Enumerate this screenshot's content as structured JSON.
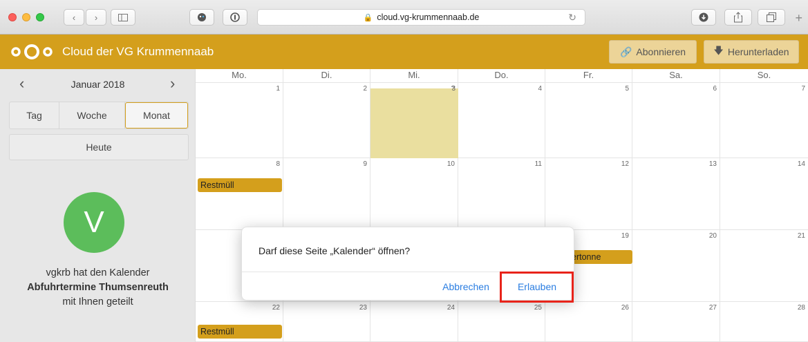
{
  "browser": {
    "url": "cloud.vg-krummennaab.de",
    "colors": {
      "close": "#fc605c",
      "minimize": "#fdbc40",
      "zoom": "#34c84a"
    }
  },
  "header": {
    "title": "Cloud der VG Krummennaab",
    "subscribe_label": "Abonnieren",
    "download_label": "Herunterladen",
    "accent": "#d49f1c"
  },
  "sidebar": {
    "month_label": "Januar 2018",
    "views": {
      "day": "Tag",
      "week": "Woche",
      "month": "Monat"
    },
    "today_label": "Heute",
    "avatar_letter": "V",
    "share_line1": "vgkrb hat den Kalender",
    "share_calendar": "Abfuhrtermine Thumsenreuth",
    "share_line3": "mit Ihnen geteilt"
  },
  "calendar": {
    "weekdays": [
      "Mo.",
      "Di.",
      "Mi.",
      "Do.",
      "Fr.",
      "Sa.",
      "So."
    ],
    "weeks": [
      [
        "1",
        "2",
        "3",
        "4",
        "5",
        "6",
        "7"
      ],
      [
        "8",
        "9",
        "10",
        "11",
        "12",
        "13",
        "14"
      ],
      [
        "",
        "",
        "",
        "",
        "19",
        "20",
        "21"
      ],
      [
        "22",
        "23",
        "24",
        "25",
        "26",
        "27",
        "28"
      ]
    ],
    "events": {
      "w2_mo": "Restmüll",
      "w3_fr": "ertonne",
      "w4_mo": "Restmüll"
    }
  },
  "dialog": {
    "message": "Darf diese Seite „Kalender“ öffnen?",
    "cancel_label": "Abbrechen",
    "allow_label": "Erlauben"
  }
}
